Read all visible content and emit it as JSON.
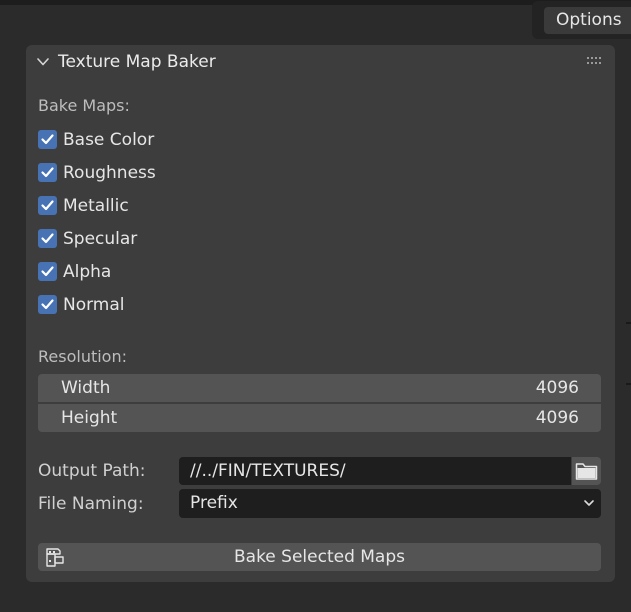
{
  "header": {
    "options_label": "Options"
  },
  "panel": {
    "title": "Texture Map Baker",
    "bake_maps_label": "Bake Maps:",
    "maps": [
      {
        "label": "Base Color",
        "checked": true
      },
      {
        "label": "Roughness",
        "checked": true
      },
      {
        "label": "Metallic",
        "checked": true
      },
      {
        "label": "Specular",
        "checked": true
      },
      {
        "label": "Alpha",
        "checked": true
      },
      {
        "label": "Normal",
        "checked": true
      }
    ],
    "resolution_label": "Resolution:",
    "width": {
      "label": "Width",
      "value": "4096"
    },
    "height": {
      "label": "Height",
      "value": "4096"
    },
    "output_path": {
      "label": "Output Path:",
      "value": "//../FIN/TEXTURES/"
    },
    "file_naming": {
      "label": "File Naming:",
      "value": "Prefix"
    },
    "bake_button": {
      "label": "Bake Selected Maps"
    }
  },
  "colors": {
    "checkbox": "#4772b3",
    "panel_bg": "#3d3d3d",
    "field_bg": "#545454",
    "input_bg": "#1e1e1e"
  }
}
